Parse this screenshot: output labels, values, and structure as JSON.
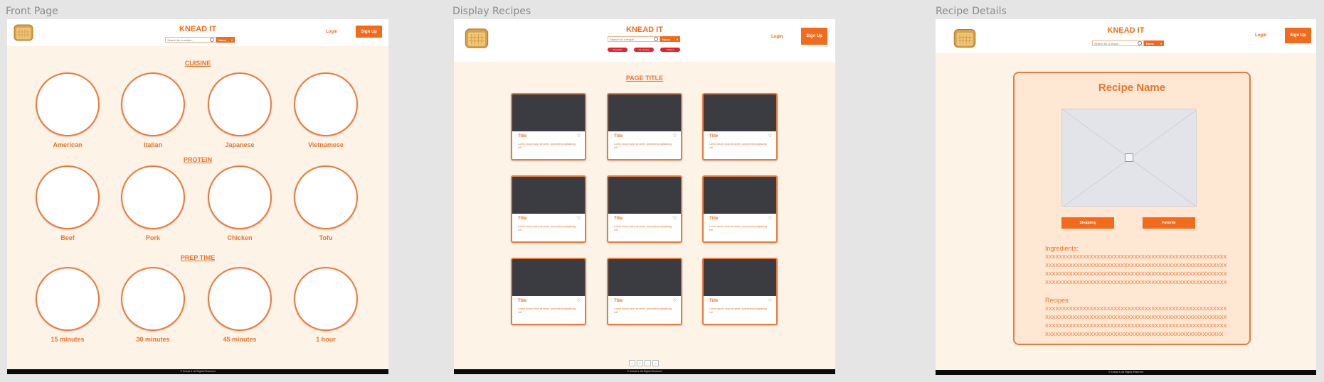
{
  "frames": [
    {
      "label": "Front Page"
    },
    {
      "label": "Display Recipes"
    },
    {
      "label": "Recipe Details"
    }
  ],
  "header": {
    "brand": "KNEAD IT",
    "search_placeholder": "Search for a recipe...",
    "filter_value": "Name",
    "login_label": "Login",
    "signup_label": "Sign Up"
  },
  "footer": {
    "text": "© Knead It. All Rights Reserved"
  },
  "front_page": {
    "sections": [
      {
        "title": "CUISINE",
        "items": [
          "American",
          "Italian",
          "Japanese",
          "Vietnamese"
        ]
      },
      {
        "title": "PROTEIN",
        "items": [
          "Beef",
          "Pork",
          "Chicken",
          "Tofu"
        ]
      },
      {
        "title": "PREP TIME",
        "items": [
          "15 minutes",
          "30 minutes",
          "45 minutes",
          "1 hour"
        ]
      }
    ]
  },
  "display_recipes": {
    "page_title": "PAGE TITLE",
    "filter_pills": [
      "American",
      "30 minutes",
      "Chicken"
    ],
    "cards": [
      {
        "title": "Title",
        "text": "Lorem ipsum dolor sit amet, consectetur adipiscing elit."
      },
      {
        "title": "Title",
        "text": "Lorem ipsum dolor sit amet, consectetur adipiscing elit."
      },
      {
        "title": "Title",
        "text": "Lorem ipsum dolor sit amet, consectetur adipiscing elit."
      },
      {
        "title": "Title",
        "text": "Lorem ipsum dolor sit amet, consectetur adipiscing elit."
      },
      {
        "title": "Title",
        "text": "Lorem ipsum dolor sit amet, consectetur adipiscing elit."
      },
      {
        "title": "Title",
        "text": "Lorem ipsum dolor sit amet, consectetur adipiscing elit."
      },
      {
        "title": "Title",
        "text": "Lorem ipsum dolor sit amet, consectetur adipiscing elit."
      },
      {
        "title": "Title",
        "text": "Lorem ipsum dolor sit amet, consectetur adipiscing elit."
      },
      {
        "title": "Title",
        "text": "Lorem ipsum dolor sit amet, consectetur adipiscing elit."
      }
    ],
    "pagination": [
      "<",
      "1",
      "...",
      ">"
    ]
  },
  "recipe_details": {
    "name": "Recipe Name",
    "shopping_label": "Shopping",
    "favorite_label": "Favorite",
    "ingredients_heading": "Ingredients:",
    "ingredients_lines": [
      "XXXXXXXXXXXXXXXXXXXXXXXXXXXXXXXXXXXXXXXXXXXXXXXXXXXXX",
      "XXXXXXXXXXXXXXXXXXXXXXXXXXXXXXXXXXXXXXXXXXXXXXXXXXXXX",
      "XXXXXXXXXXXXXXXXXXXXXXXXXXXXXXXXXXXXXXXXXXXXXXXXXXXXX",
      "XXXXXXXXXXXXXXXXXXXXXXXXXXXXXXXXXXXXXXXXXXXXXXXXXXXXX"
    ],
    "recipes_heading": "Recipes:",
    "recipes_lines": [
      "XXXXXXXXXXXXXXXXXXXXXXXXXXXXXXXXXXXXXXXXXXXXXXXXXXXXX",
      "XXXXXXXXXXXXXXXXXXXXXXXXXXXXXXXXXXXXXXXXXXXXXXXXXXXXX",
      "XXXXXXXXXXXXXXXXXXXXXXXXXXXXXXXXXXXXXXXXXXXXXXXXXXXXX",
      "XXXXXXXXXXXXXXXXXXXXXXXXXXXXXXXXXXXXXXXXXXXXXXXXXXXX"
    ]
  },
  "colors": {
    "accent": "#f26a1b",
    "page_bg": "#fdf3e7",
    "card_image": "#3a3c42",
    "pill_red": "#e8202a"
  }
}
